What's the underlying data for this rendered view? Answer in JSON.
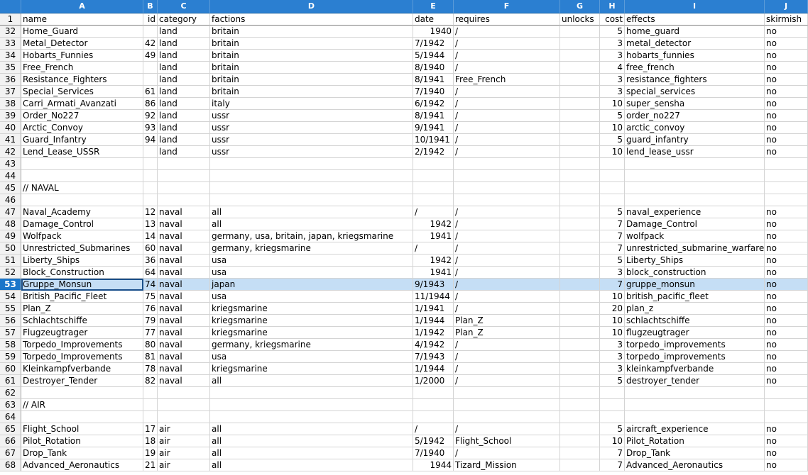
{
  "columns": [
    "A",
    "B",
    "C",
    "D",
    "E",
    "F",
    "G",
    "H",
    "I",
    "J"
  ],
  "header_row": {
    "n": "1",
    "cells": [
      "name",
      "id",
      "category",
      "factions",
      "date",
      "requires",
      "unlocks",
      "cost",
      "effects",
      "skirmish"
    ]
  },
  "selected_row": "53",
  "rows": [
    {
      "n": "32",
      "cells": [
        "Home_Guard",
        "",
        "land",
        "britain",
        "1940",
        "/",
        "",
        "5",
        "home_guard",
        "no"
      ]
    },
    {
      "n": "33",
      "cells": [
        "Metal_Detector",
        "42",
        "land",
        "britain",
        "7/1942",
        "/",
        "",
        "3",
        "metal_detector",
        "no"
      ]
    },
    {
      "n": "34",
      "cells": [
        "Hobarts_Funnies",
        "49",
        "land",
        "britain",
        "5/1944",
        "/",
        "",
        "3",
        "hobarts_funnies",
        "no"
      ]
    },
    {
      "n": "35",
      "cells": [
        "Free_French",
        "",
        "land",
        "britain",
        "8/1940",
        "/",
        "",
        "4",
        "free_french",
        "no"
      ]
    },
    {
      "n": "36",
      "cells": [
        "Resistance_Fighters",
        "",
        "land",
        "britain",
        "8/1941",
        "Free_French",
        "",
        "3",
        "resistance_fighters",
        "no"
      ]
    },
    {
      "n": "37",
      "cells": [
        "Special_Services",
        "61",
        "land",
        "britain",
        "7/1940",
        "/",
        "",
        "3",
        "special_services",
        "no"
      ]
    },
    {
      "n": "38",
      "cells": [
        "Carri_Armati_Avanzati",
        "86",
        "land",
        "italy",
        "6/1942",
        "/",
        "",
        "10",
        "super_sensha",
        "no"
      ]
    },
    {
      "n": "39",
      "cells": [
        "Order_No227",
        "92",
        "land",
        "ussr",
        "8/1941",
        "/",
        "",
        "5",
        "order_no227",
        "no"
      ]
    },
    {
      "n": "40",
      "cells": [
        "Arctic_Convoy",
        "93",
        "land",
        "ussr",
        "9/1941",
        "/",
        "",
        "10",
        "arctic_convoy",
        "no"
      ]
    },
    {
      "n": "41",
      "cells": [
        "Guard_Infantry",
        "94",
        "land",
        "ussr",
        "10/1941",
        "/",
        "",
        "5",
        "guard_infantry",
        "no"
      ]
    },
    {
      "n": "42",
      "cells": [
        "Lend_Lease_USSR",
        "",
        "land",
        "ussr",
        "2/1942",
        "/",
        "",
        "10",
        "lend_lease_ussr",
        "no"
      ]
    },
    {
      "n": "43",
      "cells": [
        "",
        "",
        "",
        "",
        "",
        "",
        "",
        "",
        "",
        ""
      ]
    },
    {
      "n": "44",
      "cells": [
        "",
        "",
        "",
        "",
        "",
        "",
        "",
        "",
        "",
        ""
      ]
    },
    {
      "n": "45",
      "cells": [
        "// NAVAL",
        "",
        "",
        "",
        "",
        "",
        "",
        "",
        "",
        ""
      ]
    },
    {
      "n": "46",
      "cells": [
        "",
        "",
        "",
        "",
        "",
        "",
        "",
        "",
        "",
        ""
      ]
    },
    {
      "n": "47",
      "cells": [
        "Naval_Academy",
        "12",
        "naval",
        "all",
        "/",
        "/",
        "",
        "5",
        "naval_experience",
        "no"
      ]
    },
    {
      "n": "48",
      "cells": [
        "Damage_Control",
        "13",
        "naval",
        "all",
        "1942",
        "/",
        "",
        "7",
        "Damage_Control",
        "no"
      ]
    },
    {
      "n": "49",
      "cells": [
        "Wolfpack",
        "14",
        "naval",
        "germany, usa, britain, japan, kriegsmarine",
        "1941",
        "/",
        "",
        "7",
        "wolfpack",
        "no"
      ]
    },
    {
      "n": "50",
      "cells": [
        "Unrestricted_Submarines",
        "60",
        "naval",
        "germany, kriegsmarine",
        "/",
        "/",
        "",
        "7",
        "unrestricted_submarine_warfare",
        "no"
      ]
    },
    {
      "n": "51",
      "cells": [
        "Liberty_Ships",
        "36",
        "naval",
        "usa",
        "1942",
        "/",
        "",
        "5",
        "Liberty_Ships",
        "no"
      ]
    },
    {
      "n": "52",
      "cells": [
        "Block_Construction",
        "64",
        "naval",
        "usa",
        "1941",
        "/",
        "",
        "3",
        "block_construction",
        "no"
      ]
    },
    {
      "n": "53",
      "cells": [
        "Gruppe_Monsun",
        "74",
        "naval",
        "japan",
        "9/1943",
        "/",
        "",
        "7",
        "gruppe_monsun",
        "no"
      ]
    },
    {
      "n": "54",
      "cells": [
        "British_Pacific_Fleet",
        "75",
        "naval",
        "usa",
        "11/1944",
        "/",
        "",
        "10",
        "british_pacific_fleet",
        "no"
      ]
    },
    {
      "n": "55",
      "cells": [
        "Plan_Z",
        "76",
        "naval",
        "kriegsmarine",
        "1/1941",
        "/",
        "",
        "20",
        "plan_z",
        "no"
      ]
    },
    {
      "n": "56",
      "cells": [
        "Schlachtschiffe",
        "79",
        "naval",
        "kriegsmarine",
        "1/1944",
        "Plan_Z",
        "",
        "10",
        "schlachtschiffe",
        "no"
      ]
    },
    {
      "n": "57",
      "cells": [
        "Flugzeugtrager",
        "77",
        "naval",
        "kriegsmarine",
        "1/1942",
        "Plan_Z",
        "",
        "10",
        "flugzeugtrager",
        "no"
      ]
    },
    {
      "n": "58",
      "cells": [
        "Torpedo_Improvements",
        "80",
        "naval",
        "germany, kriegsmarine",
        "4/1942",
        "/",
        "",
        "3",
        "torpedo_improvements",
        "no"
      ]
    },
    {
      "n": "59",
      "cells": [
        "Torpedo_Improvements",
        "81",
        "naval",
        "usa",
        "7/1943",
        "/",
        "",
        "3",
        "torpedo_improvements",
        "no"
      ]
    },
    {
      "n": "60",
      "cells": [
        "Kleinkampfverbande",
        "78",
        "naval",
        "kriegsmarine",
        "1/1944",
        "/",
        "",
        "3",
        "kleinkampfverbande",
        "no"
      ]
    },
    {
      "n": "61",
      "cells": [
        "Destroyer_Tender",
        "82",
        "naval",
        "all",
        "1/2000",
        "/",
        "",
        "5",
        "destroyer_tender",
        "no"
      ]
    },
    {
      "n": "62",
      "cells": [
        "",
        "",
        "",
        "",
        "",
        "",
        "",
        "",
        "",
        ""
      ]
    },
    {
      "n": "63",
      "cells": [
        "// AIR",
        "",
        "",
        "",
        "",
        "",
        "",
        "",
        "",
        ""
      ]
    },
    {
      "n": "64",
      "cells": [
        "",
        "",
        "",
        "",
        "",
        "",
        "",
        "",
        "",
        ""
      ]
    },
    {
      "n": "65",
      "cells": [
        "Flight_School",
        "17",
        "air",
        "all",
        "/",
        "/",
        "",
        "5",
        "aircraft_experience",
        "no"
      ]
    },
    {
      "n": "66",
      "cells": [
        "Pilot_Rotation",
        "18",
        "air",
        "all",
        "5/1942",
        "Flight_School",
        "",
        "10",
        "Pilot_Rotation",
        "no"
      ]
    },
    {
      "n": "67",
      "cells": [
        "Drop_Tank",
        "19",
        "air",
        "all",
        "7/1940",
        "/",
        "",
        "7",
        "Drop_Tank",
        "no"
      ]
    },
    {
      "n": "68",
      "cells": [
        "Advanced_Aeronautics",
        "21",
        "air",
        "all",
        "1944",
        "Tizard_Mission",
        "",
        "7",
        "Advanced_Aeronautics",
        "no"
      ]
    }
  ]
}
